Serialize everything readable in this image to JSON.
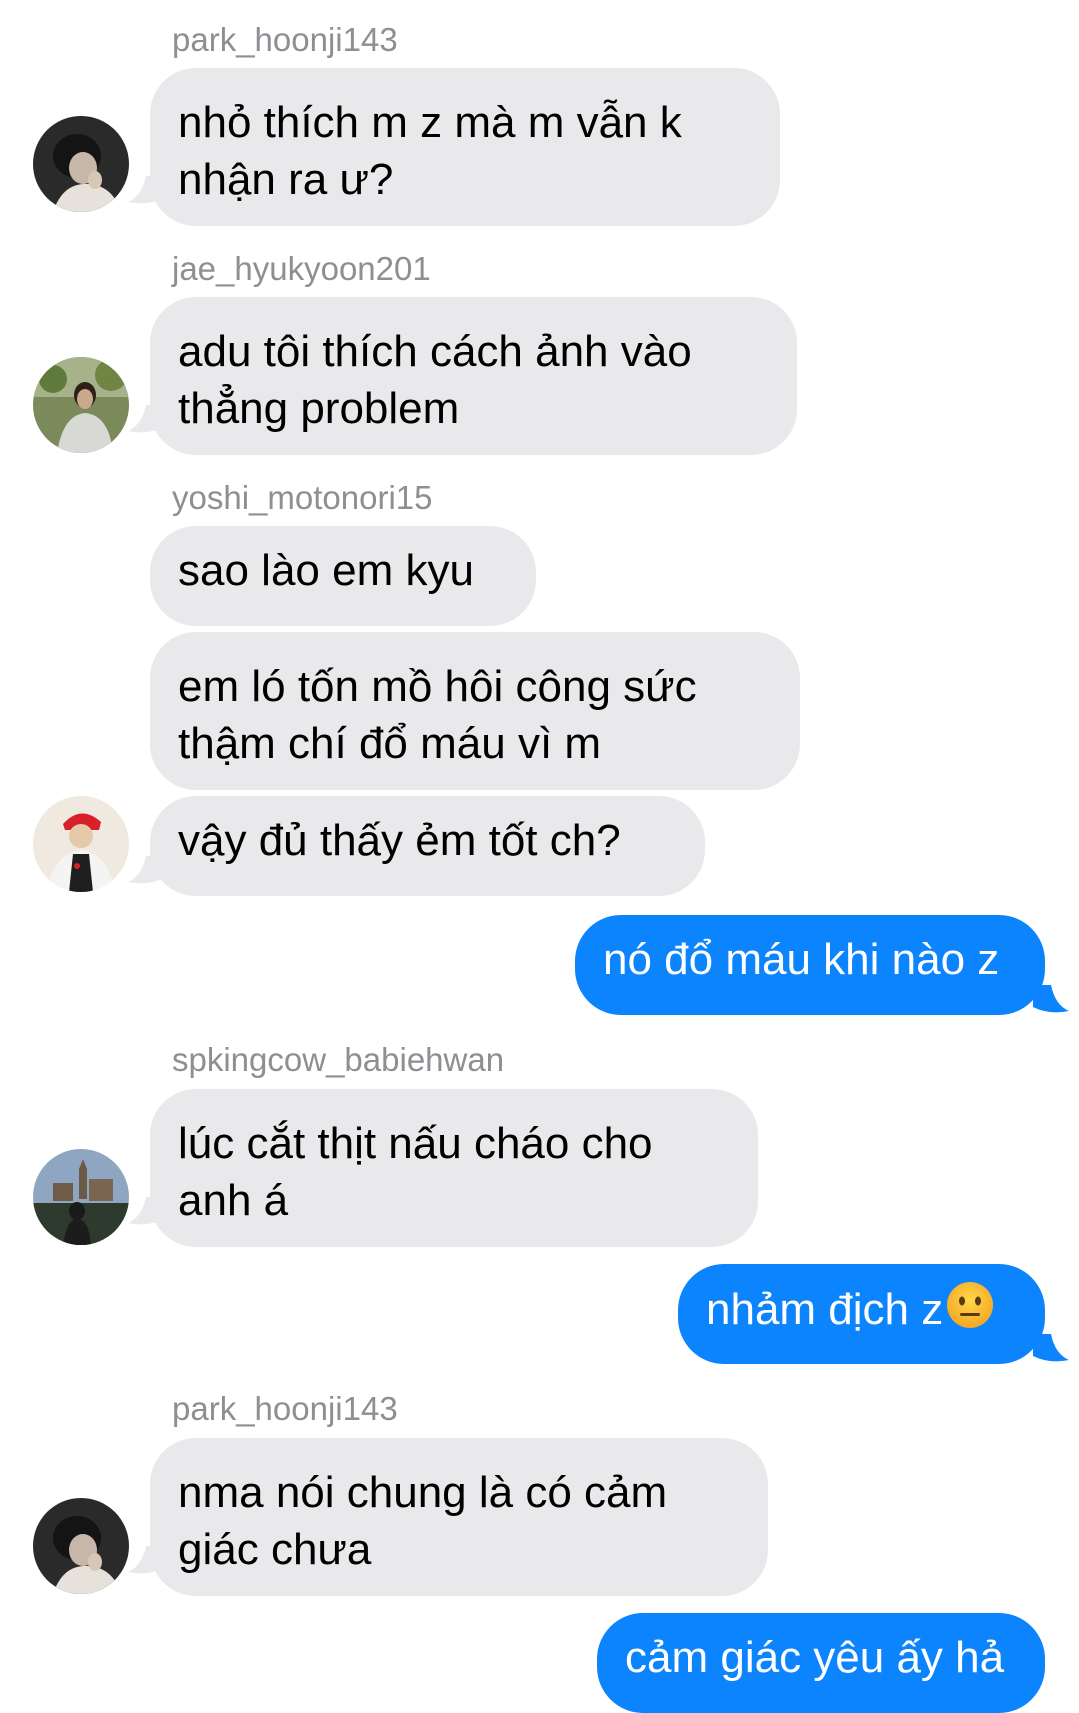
{
  "messages": [
    {
      "id": 1,
      "direction": "incoming",
      "sender": "park_hoonji143",
      "avatar": "profile-photo-hoonji",
      "text": "nhỏ thích m z mà m vẫn k\nnhận ra ư?"
    },
    {
      "id": 2,
      "direction": "incoming",
      "sender": "jae_hyukyoon201",
      "avatar": "profile-photo-hyukyoon",
      "text": "adu tôi thích cách ảnh vào\nthẳng problem"
    },
    {
      "id": 3,
      "direction": "incoming",
      "sender": "yoshi_motonori15",
      "text": "sao lào em kyu"
    },
    {
      "id": 4,
      "direction": "incoming",
      "text": "em ló tốn mồ hôi công sức\nthậm chí đổ máu vì m"
    },
    {
      "id": 5,
      "direction": "incoming",
      "avatar": "profile-photo-motonori",
      "text": "vậy đủ thấy ẻm tốt ch?"
    },
    {
      "id": 6,
      "direction": "outgoing",
      "text": "nó đổ máu khi nào z"
    },
    {
      "id": 7,
      "direction": "incoming",
      "sender": "spkingcow_babiehwan",
      "avatar": "profile-photo-babiehwan",
      "text": "lúc cắt thịt nấu cháo cho\nanh á"
    },
    {
      "id": 8,
      "direction": "outgoing",
      "text": "nhảm địch z",
      "emoji": "neutral-face-emoji"
    },
    {
      "id": 9,
      "direction": "incoming",
      "sender": "park_hoonji143",
      "avatar": "profile-photo-hoonji",
      "text": "nma nói chung là có cảm\ngiác chưa"
    },
    {
      "id": 10,
      "direction": "outgoing",
      "text": "cảm giác yêu ấy hả"
    }
  ],
  "colors": {
    "incoming_bubble": "#e9e9eb",
    "outgoing_bubble": "#0b84fe",
    "sender_name": "#8e8e93"
  }
}
